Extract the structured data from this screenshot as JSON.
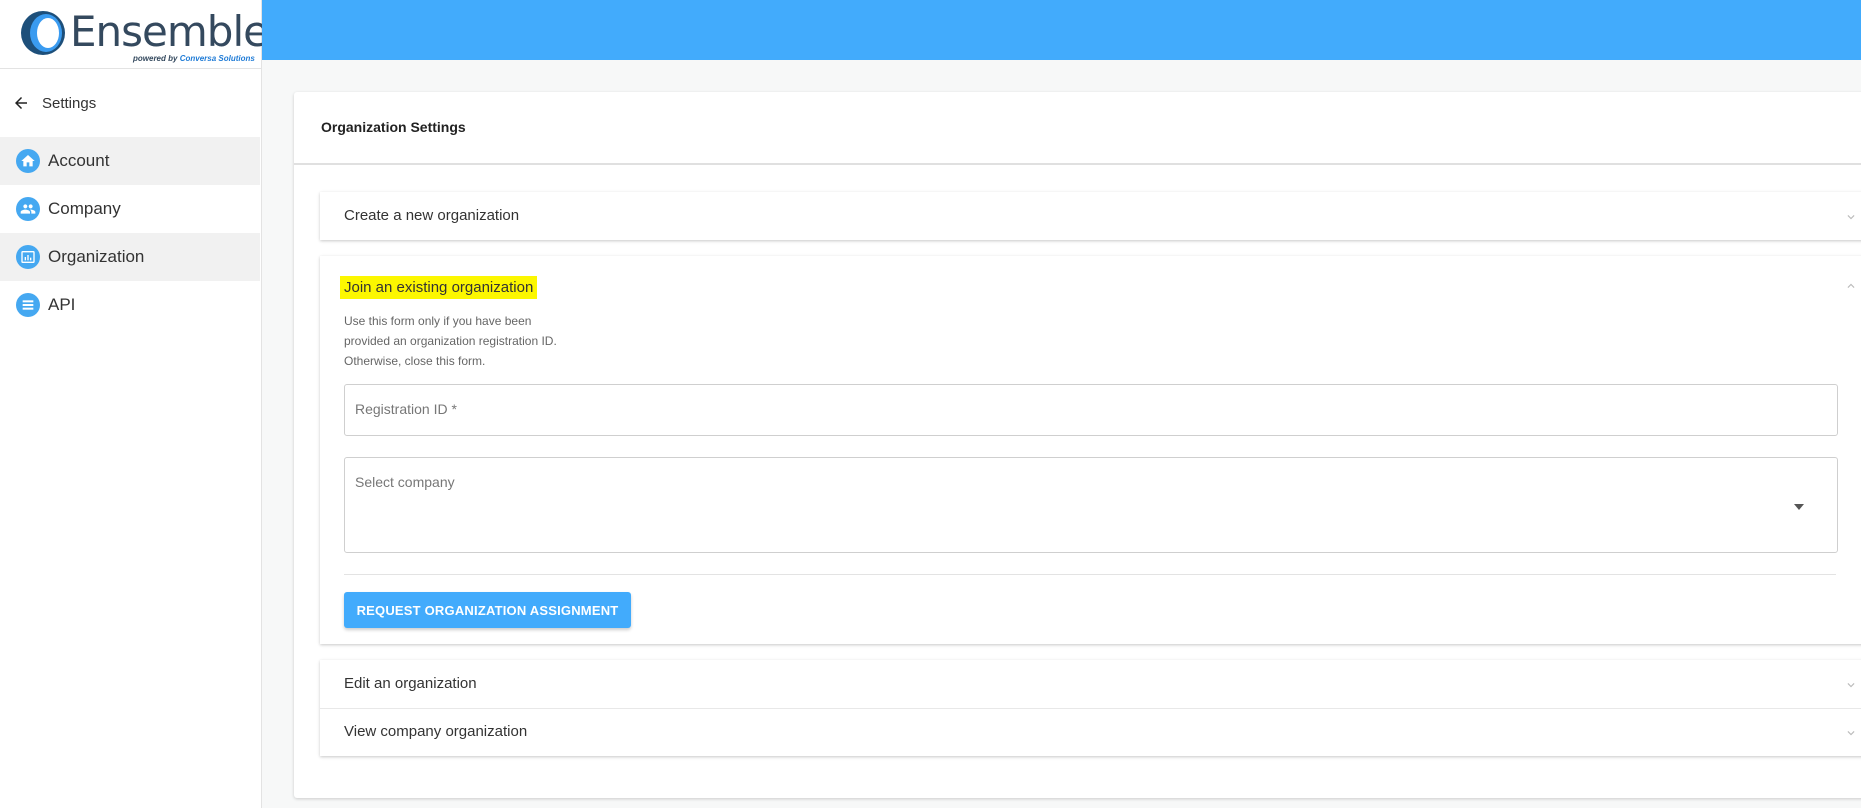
{
  "brand": {
    "name": "Ensemble",
    "tagline_prefix": "powered by",
    "tagline_brand": "Conversa Solutions"
  },
  "sidebar": {
    "back_label": "Settings",
    "items": [
      {
        "label": "Account",
        "icon": "home-icon"
      },
      {
        "label": "Company",
        "icon": "people-icon"
      },
      {
        "label": "Organization",
        "icon": "org-chart-icon"
      },
      {
        "label": "API",
        "icon": "list-icon"
      }
    ]
  },
  "main": {
    "title": "Organization Settings",
    "panels": {
      "create": {
        "title": "Create a new organization"
      },
      "join": {
        "title": "Join an existing organization",
        "help_lines": [
          "Use this form only if you have been",
          "provided an organization registration ID.",
          "Otherwise, close this form."
        ],
        "registration_label": "Registration ID *",
        "company_label": "Select company",
        "submit_label": "REQUEST ORGANIZATION ASSIGNMENT"
      },
      "edit": {
        "title": "Edit an organization"
      },
      "view": {
        "title": "View company organization"
      }
    }
  },
  "colors": {
    "accent": "#42abfc",
    "highlight": "#fcf700",
    "icon_bg": "#45a8f1"
  }
}
